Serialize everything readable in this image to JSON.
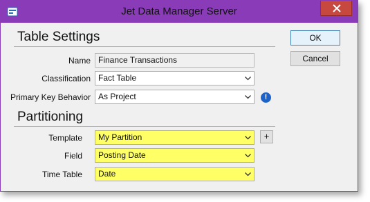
{
  "window": {
    "title": "Jet Data Manager Server",
    "accent_color": "#8a3bb8",
    "icon": "app-icon"
  },
  "buttons": {
    "ok_label": "OK",
    "cancel_label": "Cancel",
    "add_label": "+"
  },
  "table_settings": {
    "header": "Table Settings",
    "name_label": "Name",
    "name_value": "Finance Transactions",
    "classification_label": "Classification",
    "classification_value": "Fact Table",
    "pk_label": "Primary Key Behavior",
    "pk_value": "As Project",
    "pk_info_glyph": "!"
  },
  "partitioning": {
    "header": "Partitioning",
    "template_label": "Template",
    "template_value": "My Partition",
    "field_label": "Field",
    "field_value": "Posting Date",
    "time_table_label": "Time Table",
    "time_table_value": "Date",
    "highlight_color": "#ffff66"
  }
}
